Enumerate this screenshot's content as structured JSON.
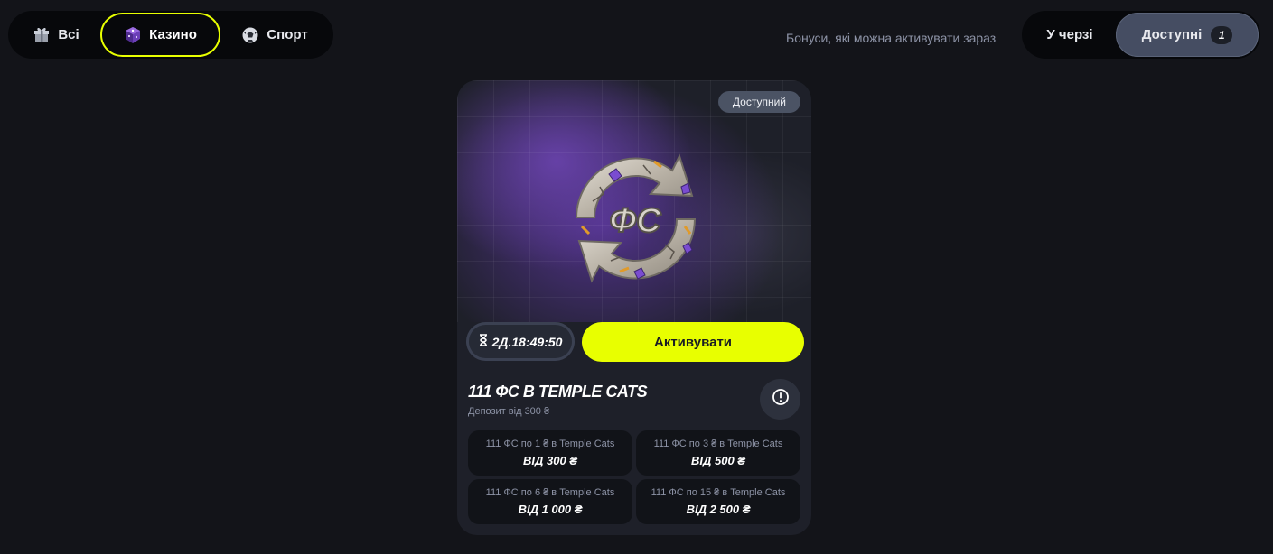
{
  "category_tabs": [
    {
      "label": "Всі",
      "icon": "gift-icon"
    },
    {
      "label": "Казино",
      "icon": "dice-icon",
      "selected": true
    },
    {
      "label": "Спорт",
      "icon": "soccer-ball-icon"
    }
  ],
  "filter": {
    "caption": "Бонуси, які можна активувати зараз",
    "queue_label": "У черзі",
    "available_label": "Доступні",
    "available_count": "1"
  },
  "card": {
    "status": "Доступний",
    "emblem_text": "ФС",
    "timer": "2Д.18:49:50",
    "activate_label": "Активувати",
    "title": "111 ФС В TEMPLE CATS",
    "subtitle": "Депозит від 300 ₴",
    "tiers": [
      {
        "desc": "111 ФС по 1 ₴ в Temple Cats",
        "amount": "ВІД 300 ₴"
      },
      {
        "desc": "111 ФС по 3 ₴ в Temple Cats",
        "amount": "ВІД 500 ₴"
      },
      {
        "desc": "111 ФС по 6 ₴ в Temple Cats",
        "amount": "ВІД 1 000 ₴"
      },
      {
        "desc": "111 ФС по 15 ₴ в Temple Cats",
        "amount": "ВІД 2 500 ₴"
      }
    ]
  },
  "colors": {
    "accent": "#e8ff00",
    "background": "#131419",
    "card": "#1e2029",
    "hero_purple": "#5a3a98"
  }
}
